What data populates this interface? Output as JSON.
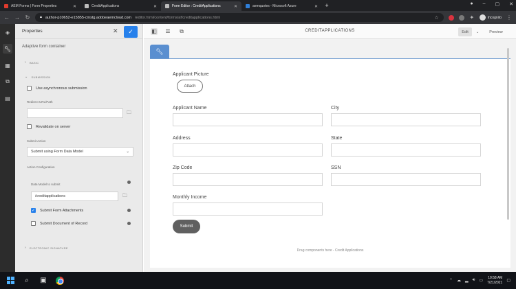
{
  "browser": {
    "tabs": [
      {
        "title": "AEM Forms | Form Properties",
        "color": "#e03b2e",
        "active": false
      },
      {
        "title": "CreditApplications",
        "color": "#bdbdbd",
        "active": false
      },
      {
        "title": "Form Editor : CreditApplications",
        "color": "#bdbdbd",
        "active": true
      },
      {
        "title": "aemquotes - Microsoft Azure",
        "color": "#2f7fd8",
        "active": false
      }
    ],
    "new_tab": "+",
    "url_host": "author-p10652-e15855-cmstg.adobeaemcloud.com",
    "url_path": "/editor.html/content/forms/af/creditapplications.html",
    "incognito_label": "Incognito"
  },
  "properties": {
    "title": "Properties",
    "component": "Adaptive form container",
    "sections": {
      "basic": "BASIC",
      "submission": "SUBMISSION",
      "electronic_signature": "ELECTRONIC SIGNATURE"
    },
    "async_label": "Use asynchronous submission",
    "redirect_label": "Redirect URL/Path",
    "redirect_value": "",
    "revalidate_label": "Revalidate on server",
    "submit_action_label": "Submit Action",
    "submit_action_value": "Submit using Form Data Model",
    "action_config_label": "Action Configuration",
    "data_model_label": "Data Model to submit",
    "data_model_value": "/creditapplications",
    "submit_attachments_label": "Submit Form Attachments",
    "submit_attachments_checked": true,
    "submit_dor_label": "Submit Document of Record",
    "submit_dor_checked": false
  },
  "editor": {
    "title": "CREDITAPPLICATIONS",
    "edit_label": "Edit",
    "preview_label": "Preview",
    "form": {
      "applicant_picture_label": "Applicant Picture",
      "attach_label": "Attach",
      "applicant_name_label": "Applicant Name",
      "city_label": "City",
      "address_label": "Address",
      "state_label": "State",
      "zip_label": "Zip Code",
      "ssn_label": "SSN",
      "income_label": "Monthly Income",
      "submit_label": "Submit"
    },
    "drag_hint": "Drag components here - Credit Applications"
  },
  "taskbar": {
    "time": "10:58 AM",
    "date": "7/21/2021"
  }
}
